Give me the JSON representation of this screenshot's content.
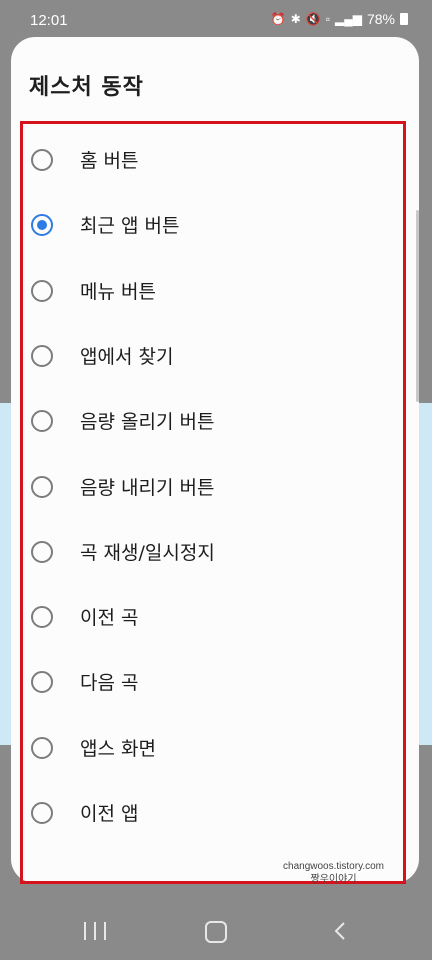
{
  "status_bar": {
    "time": "12:01",
    "battery_percent": "78%",
    "icons": [
      "alarm-icon",
      "bluetooth-icon",
      "mute-icon",
      "5g-icon",
      "signal-icon",
      "battery-icon"
    ]
  },
  "dialog": {
    "title": "제스처 동작",
    "selected_index": 1,
    "accent_color": "#2e7be6",
    "highlight_border_color": "#d5131e",
    "options": [
      {
        "label": "홈 버튼"
      },
      {
        "label": "최근 앱 버튼"
      },
      {
        "label": "메뉴 버튼"
      },
      {
        "label": "앱에서 찾기"
      },
      {
        "label": "음량 올리기 버튼"
      },
      {
        "label": "음량 내리기 버튼"
      },
      {
        "label": "곡 재생/일시정지"
      },
      {
        "label": "이전 곡"
      },
      {
        "label": "다음 곡"
      },
      {
        "label": "앱스 화면"
      },
      {
        "label": "이전 앱"
      }
    ]
  },
  "watermark": {
    "line1": "changwoos.tistory.com",
    "line2": "짱우이야기"
  },
  "nav_bar": {
    "buttons": [
      "recents-icon",
      "home-icon",
      "back-icon"
    ]
  }
}
